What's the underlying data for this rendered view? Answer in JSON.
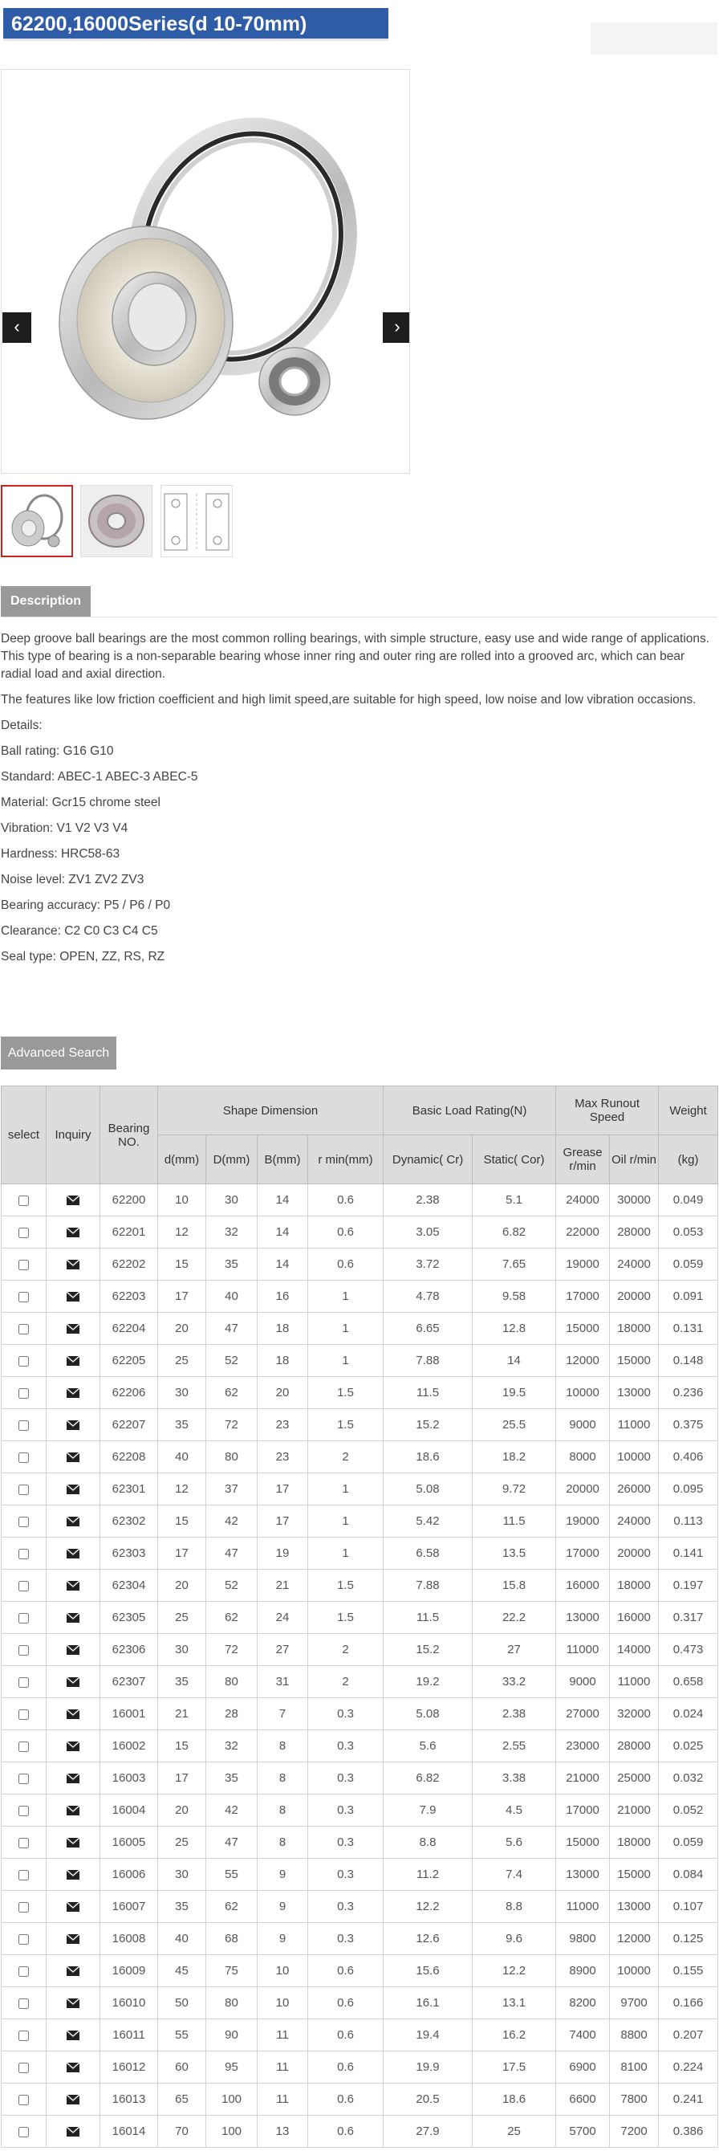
{
  "header": {
    "title": "62200,16000Series(d 10-70mm)"
  },
  "gallery": {
    "prev_icon": "chevron-left",
    "next_icon": "chevron-right",
    "prev_glyph": "‹",
    "next_glyph": "›"
  },
  "description": {
    "tab_label": "Description",
    "paragraphs": [
      "Deep groove ball bearings are the most common rolling bearings, with simple structure, easy use and wide range of applications. This type of bearing is a non-separable bearing whose inner ring and outer ring are rolled into a grooved arc, which can bear radial load and axial direction.",
      "The features like low friction coefficient and high limit speed,are suitable for high speed, low noise and low vibration occasions."
    ],
    "details_heading": "Details:",
    "details": [
      "Ball rating: G16 G10",
      "Standard: ABEC-1 ABEC-3 ABEC-5",
      "Material: Gcr15 chrome steel",
      "Vibration: V1 V2 V3 V4",
      "Hardness: HRC58-63",
      "Noise level: ZV1 ZV2 ZV3",
      "Bearing accuracy: P5 / P6 / P0",
      "Clearance: C2 C0 C3 C4 C5",
      "Seal type: OPEN, ZZ, RS, RZ"
    ]
  },
  "search": {
    "button_label": "Advanced Search"
  },
  "table": {
    "headers": {
      "select": "select",
      "inquiry": "Inquiry",
      "bearing_no": "Bearing NO.",
      "shape": "Shape Dimension",
      "load": "Basic Load Rating(N)",
      "speed": "Max Runout Speed",
      "weight": "Weight",
      "d": "d(mm)",
      "D": "D(mm)",
      "B": "B(mm)",
      "rmin": "r min(mm)",
      "dynamic": "Dynamic( Cr)",
      "static": "Static( Cor)",
      "grease": "Grease r/min",
      "oil": "Oil r/min",
      "kg": "(kg)"
    },
    "inquiry_icon": "envelope-icon",
    "rows": [
      [
        "62200",
        "10",
        "30",
        "14",
        "0.6",
        "2.38",
        "5.1",
        "24000",
        "30000",
        "0.049"
      ],
      [
        "62201",
        "12",
        "32",
        "14",
        "0.6",
        "3.05",
        "6.82",
        "22000",
        "28000",
        "0.053"
      ],
      [
        "62202",
        "15",
        "35",
        "14",
        "0.6",
        "3.72",
        "7.65",
        "19000",
        "24000",
        "0.059"
      ],
      [
        "62203",
        "17",
        "40",
        "16",
        "1",
        "4.78",
        "9.58",
        "17000",
        "20000",
        "0.091"
      ],
      [
        "62204",
        "20",
        "47",
        "18",
        "1",
        "6.65",
        "12.8",
        "15000",
        "18000",
        "0.131"
      ],
      [
        "62205",
        "25",
        "52",
        "18",
        "1",
        "7.88",
        "14",
        "12000",
        "15000",
        "0.148"
      ],
      [
        "62206",
        "30",
        "62",
        "20",
        "1.5",
        "11.5",
        "19.5",
        "10000",
        "13000",
        "0.236"
      ],
      [
        "62207",
        "35",
        "72",
        "23",
        "1.5",
        "15.2",
        "25.5",
        "9000",
        "11000",
        "0.375"
      ],
      [
        "62208",
        "40",
        "80",
        "23",
        "2",
        "18.6",
        "18.2",
        "8000",
        "10000",
        "0.406"
      ],
      [
        "62301",
        "12",
        "37",
        "17",
        "1",
        "5.08",
        "9.72",
        "20000",
        "26000",
        "0.095"
      ],
      [
        "62302",
        "15",
        "42",
        "17",
        "1",
        "5.42",
        "11.5",
        "19000",
        "24000",
        "0.113"
      ],
      [
        "62303",
        "17",
        "47",
        "19",
        "1",
        "6.58",
        "13.5",
        "17000",
        "20000",
        "0.141"
      ],
      [
        "62304",
        "20",
        "52",
        "21",
        "1.5",
        "7.88",
        "15.8",
        "16000",
        "18000",
        "0.197"
      ],
      [
        "62305",
        "25",
        "62",
        "24",
        "1.5",
        "11.5",
        "22.2",
        "13000",
        "16000",
        "0.317"
      ],
      [
        "62306",
        "30",
        "72",
        "27",
        "2",
        "15.2",
        "27",
        "11000",
        "14000",
        "0.473"
      ],
      [
        "62307",
        "35",
        "80",
        "31",
        "2",
        "19.2",
        "33.2",
        "9000",
        "11000",
        "0.658"
      ],
      [
        "16001",
        "21",
        "28",
        "7",
        "0.3",
        "5.08",
        "2.38",
        "27000",
        "32000",
        "0.024"
      ],
      [
        "16002",
        "15",
        "32",
        "8",
        "0.3",
        "5.6",
        "2.55",
        "23000",
        "28000",
        "0.025"
      ],
      [
        "16003",
        "17",
        "35",
        "8",
        "0.3",
        "6.82",
        "3.38",
        "21000",
        "25000",
        "0.032"
      ],
      [
        "16004",
        "20",
        "42",
        "8",
        "0.3",
        "7.9",
        "4.5",
        "17000",
        "21000",
        "0.052"
      ],
      [
        "16005",
        "25",
        "47",
        "8",
        "0.3",
        "8.8",
        "5.6",
        "15000",
        "18000",
        "0.059"
      ],
      [
        "16006",
        "30",
        "55",
        "9",
        "0.3",
        "11.2",
        "7.4",
        "13000",
        "15000",
        "0.084"
      ],
      [
        "16007",
        "35",
        "62",
        "9",
        "0.3",
        "12.2",
        "8.8",
        "11000",
        "13000",
        "0.107"
      ],
      [
        "16008",
        "40",
        "68",
        "9",
        "0.3",
        "12.6",
        "9.6",
        "9800",
        "12000",
        "0.125"
      ],
      [
        "16009",
        "45",
        "75",
        "10",
        "0.6",
        "15.6",
        "12.2",
        "8900",
        "10000",
        "0.155"
      ],
      [
        "16010",
        "50",
        "80",
        "10",
        "0.6",
        "16.1",
        "13.1",
        "8200",
        "9700",
        "0.166"
      ],
      [
        "16011",
        "55",
        "90",
        "11",
        "0.6",
        "19.4",
        "16.2",
        "7400",
        "8800",
        "0.207"
      ],
      [
        "16012",
        "60",
        "95",
        "11",
        "0.6",
        "19.9",
        "17.5",
        "6900",
        "8100",
        "0.224"
      ],
      [
        "16013",
        "65",
        "100",
        "11",
        "0.6",
        "20.5",
        "18.6",
        "6600",
        "7800",
        "0.241"
      ],
      [
        "16014",
        "70",
        "100",
        "13",
        "0.6",
        "27.9",
        "25",
        "5700",
        "7200",
        "0.386"
      ]
    ]
  }
}
